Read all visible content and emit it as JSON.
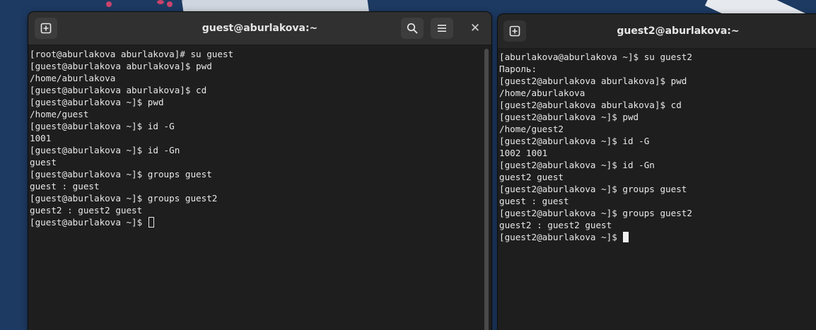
{
  "desktop": {
    "accent": "#1d3a62"
  },
  "left_window": {
    "title": "guest@aburlakova:~",
    "icons": {
      "new_tab": "new-tab-icon",
      "search": "search-icon",
      "menu": "hamburger-menu-icon",
      "close": "close-icon"
    },
    "close_glyph": "✕",
    "lines": [
      "[root@aburlakova aburlakova]# su guest",
      "[guest@aburlakova aburlakova]$ pwd",
      "/home/aburlakova",
      "[guest@aburlakova aburlakova]$ cd",
      "[guest@aburlakova ~]$ pwd",
      "/home/guest",
      "[guest@aburlakova ~]$ id -G",
      "1001",
      "[guest@aburlakova ~]$ id -Gn",
      "guest",
      "[guest@aburlakova ~]$ groups guest",
      "guest : guest",
      "[guest@aburlakova ~]$ groups guest2",
      "guest2 : guest2 guest"
    ],
    "prompt": "[guest@aburlakova ~]$ "
  },
  "right_window": {
    "title": "guest2@aburlakova:~",
    "icons": {
      "new_tab": "new-tab-icon"
    },
    "lines": [
      "[aburlakova@aburlakova ~]$ su guest2",
      "Пароль:",
      "[guest2@aburlakova aburlakova]$ pwd",
      "/home/aburlakova",
      "[guest2@aburlakova aburlakova]$ cd",
      "[guest2@aburlakova ~]$ pwd",
      "/home/guest2",
      "[guest2@aburlakova ~]$ id -G",
      "1002 1001",
      "[guest2@aburlakova ~]$ id -Gn",
      "guest2 guest",
      "[guest2@aburlakova ~]$ groups guest",
      "guest : guest",
      "[guest2@aburlakova ~]$ groups guest2",
      "guest2 : guest2 guest"
    ],
    "prompt": "[guest2@aburlakova ~]$ "
  }
}
